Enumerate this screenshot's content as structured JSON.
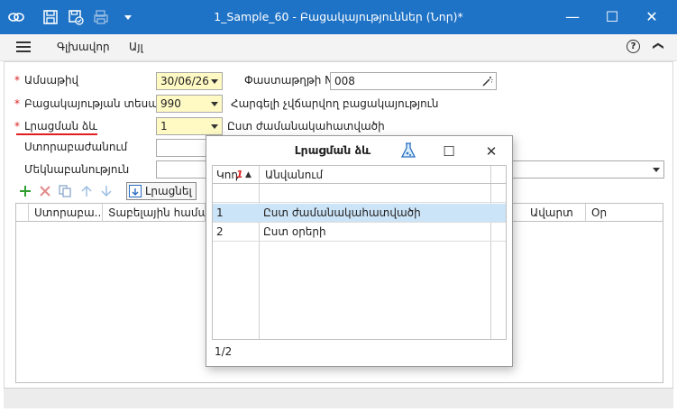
{
  "window": {
    "title": "1_Sample_60 - Բացակայություններ (Նոր)*",
    "controls": {
      "minimize": "—",
      "maximize": "☐",
      "close": "✕"
    }
  },
  "menu": {
    "items": [
      "Գլխավոր",
      "Այլ"
    ],
    "help": "?",
    "collapse": "❯"
  },
  "form": {
    "date": {
      "label": "Ամսաթիվ",
      "value": "30/06/26"
    },
    "doc_number": {
      "label": "Փաստաթղթի N",
      "value": "008"
    },
    "absence_type": {
      "label": "Բացակայության տեսակ",
      "value": "990",
      "description": "Հարգելի չվճարվող բացակայություն"
    },
    "fill_method": {
      "label": "Լրացման ձև",
      "value": "1",
      "description": "Ըստ ժամանակահատվածի"
    },
    "division": {
      "label": "Ստորաբաժանում",
      "value": ""
    },
    "comment": {
      "label": "Մեկնաբանություն",
      "value": ""
    }
  },
  "toolbar": {
    "fill_label": "Լրացնել"
  },
  "grid": {
    "columns": [
      "Ստորաբա...",
      "Տաբելային համար",
      "Ավարտ",
      "Օր"
    ]
  },
  "dialog": {
    "title": "Լրացման ձև",
    "columns": {
      "code": "Կոդ",
      "name": "Անվանում"
    },
    "rows": [
      {
        "code": "1",
        "name": "Ըստ ժամանակահատվածի"
      },
      {
        "code": "2",
        "name": "Ըստ օրերի"
      }
    ],
    "pager": "1/2",
    "maximize": "☐",
    "close": "✕"
  },
  "colors": {
    "titlebar": "#1f73c6",
    "required": "#d22222",
    "selected_row": "#cce4f7",
    "yellow_field": "#fff9c4"
  }
}
